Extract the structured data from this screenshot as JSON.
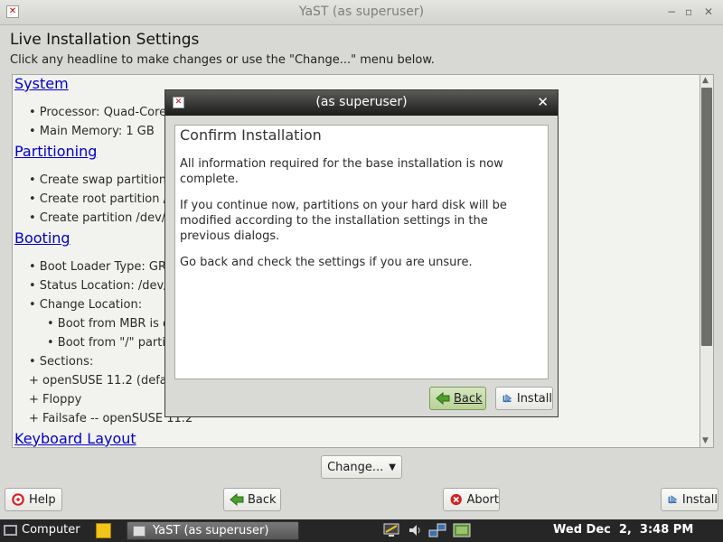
{
  "window": {
    "title": "YaST (as superuser)"
  },
  "page": {
    "heading": "Live Installation Settings",
    "subheading": "Click any headline to make changes or use the \"Change...\" menu below."
  },
  "summary": {
    "system": {
      "link": "System",
      "items": [
        "• Processor: Quad-Core",
        "• Main Memory: 1 GB"
      ]
    },
    "partitioning": {
      "link": "Partitioning",
      "items": [
        "• Create swap partition",
        "• Create root partition /",
        "• Create partition /dev/s"
      ]
    },
    "booting": {
      "link": "Booting",
      "items": [
        "• Boot Loader Type: GR",
        "• Status Location: /dev/",
        "• Change Location:",
        "• Boot from MBR is d",
        "• Boot from \"/\" partit",
        "• Sections:",
        "+ openSUSE 11.2 (defa",
        "+ Floppy",
        "+ Failsafe -- openSUSE 11.2"
      ]
    },
    "keyboard": {
      "link": "Keyboard Layout"
    }
  },
  "buttons": {
    "change": "Change...",
    "help": "Help",
    "back": "Back",
    "abort": "Abort",
    "install": "Install"
  },
  "dialog": {
    "title": "(as superuser)",
    "heading": "Confirm Installation",
    "para1": "All information required for the base installation is now complete.",
    "para2": "If you continue now, partitions on your hard disk will be modified according to the installation settings in the previous dialogs.",
    "para3": "Go back and check the settings if you are unsure.",
    "back": "Back",
    "install": "Install"
  },
  "taskbar": {
    "computer": "Computer",
    "task": "YaST (as superuser)",
    "clock": "Wed Dec  2,  3:48 PM"
  },
  "colors": {
    "link": "#0000c8",
    "back_button_active": "#c9dcae",
    "abort_icon": "#d42020",
    "help_icon": "#d42020"
  }
}
